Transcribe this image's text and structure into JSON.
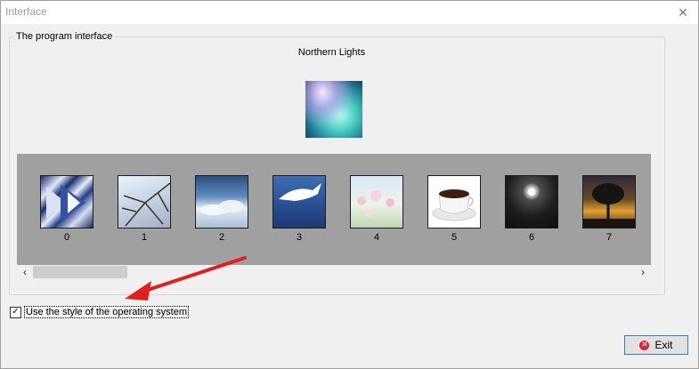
{
  "window": {
    "title": "Interface",
    "close_glyph": "✕"
  },
  "group": {
    "title": "The program interface",
    "selected_name": "Northern Lights"
  },
  "gallery": {
    "thumbnails": [
      {
        "label": "0",
        "icon": "abstract-blue-pattern"
      },
      {
        "label": "1",
        "icon": "bare-tree-branches"
      },
      {
        "label": "2",
        "icon": "sky-clouds"
      },
      {
        "label": "3",
        "icon": "whale-underwater"
      },
      {
        "label": "4",
        "icon": "flowers"
      },
      {
        "label": "5",
        "icon": "coffee-cup"
      },
      {
        "label": "6",
        "icon": "night-moon"
      },
      {
        "label": "7",
        "icon": "tree-sunset"
      }
    ],
    "scroll_left_glyph": "‹",
    "scroll_right_glyph": "›"
  },
  "options": {
    "use_os_style_label": "Use the style of the operating system",
    "use_os_style_checked": true,
    "check_glyph": "✓"
  },
  "buttons": {
    "exit_label": "Exit",
    "exit_icon_glyph": "✕"
  },
  "colors": {
    "gallery_bg": "#a0a0a0",
    "arrow": "#e02020",
    "exit_icon": "#d7263d"
  }
}
